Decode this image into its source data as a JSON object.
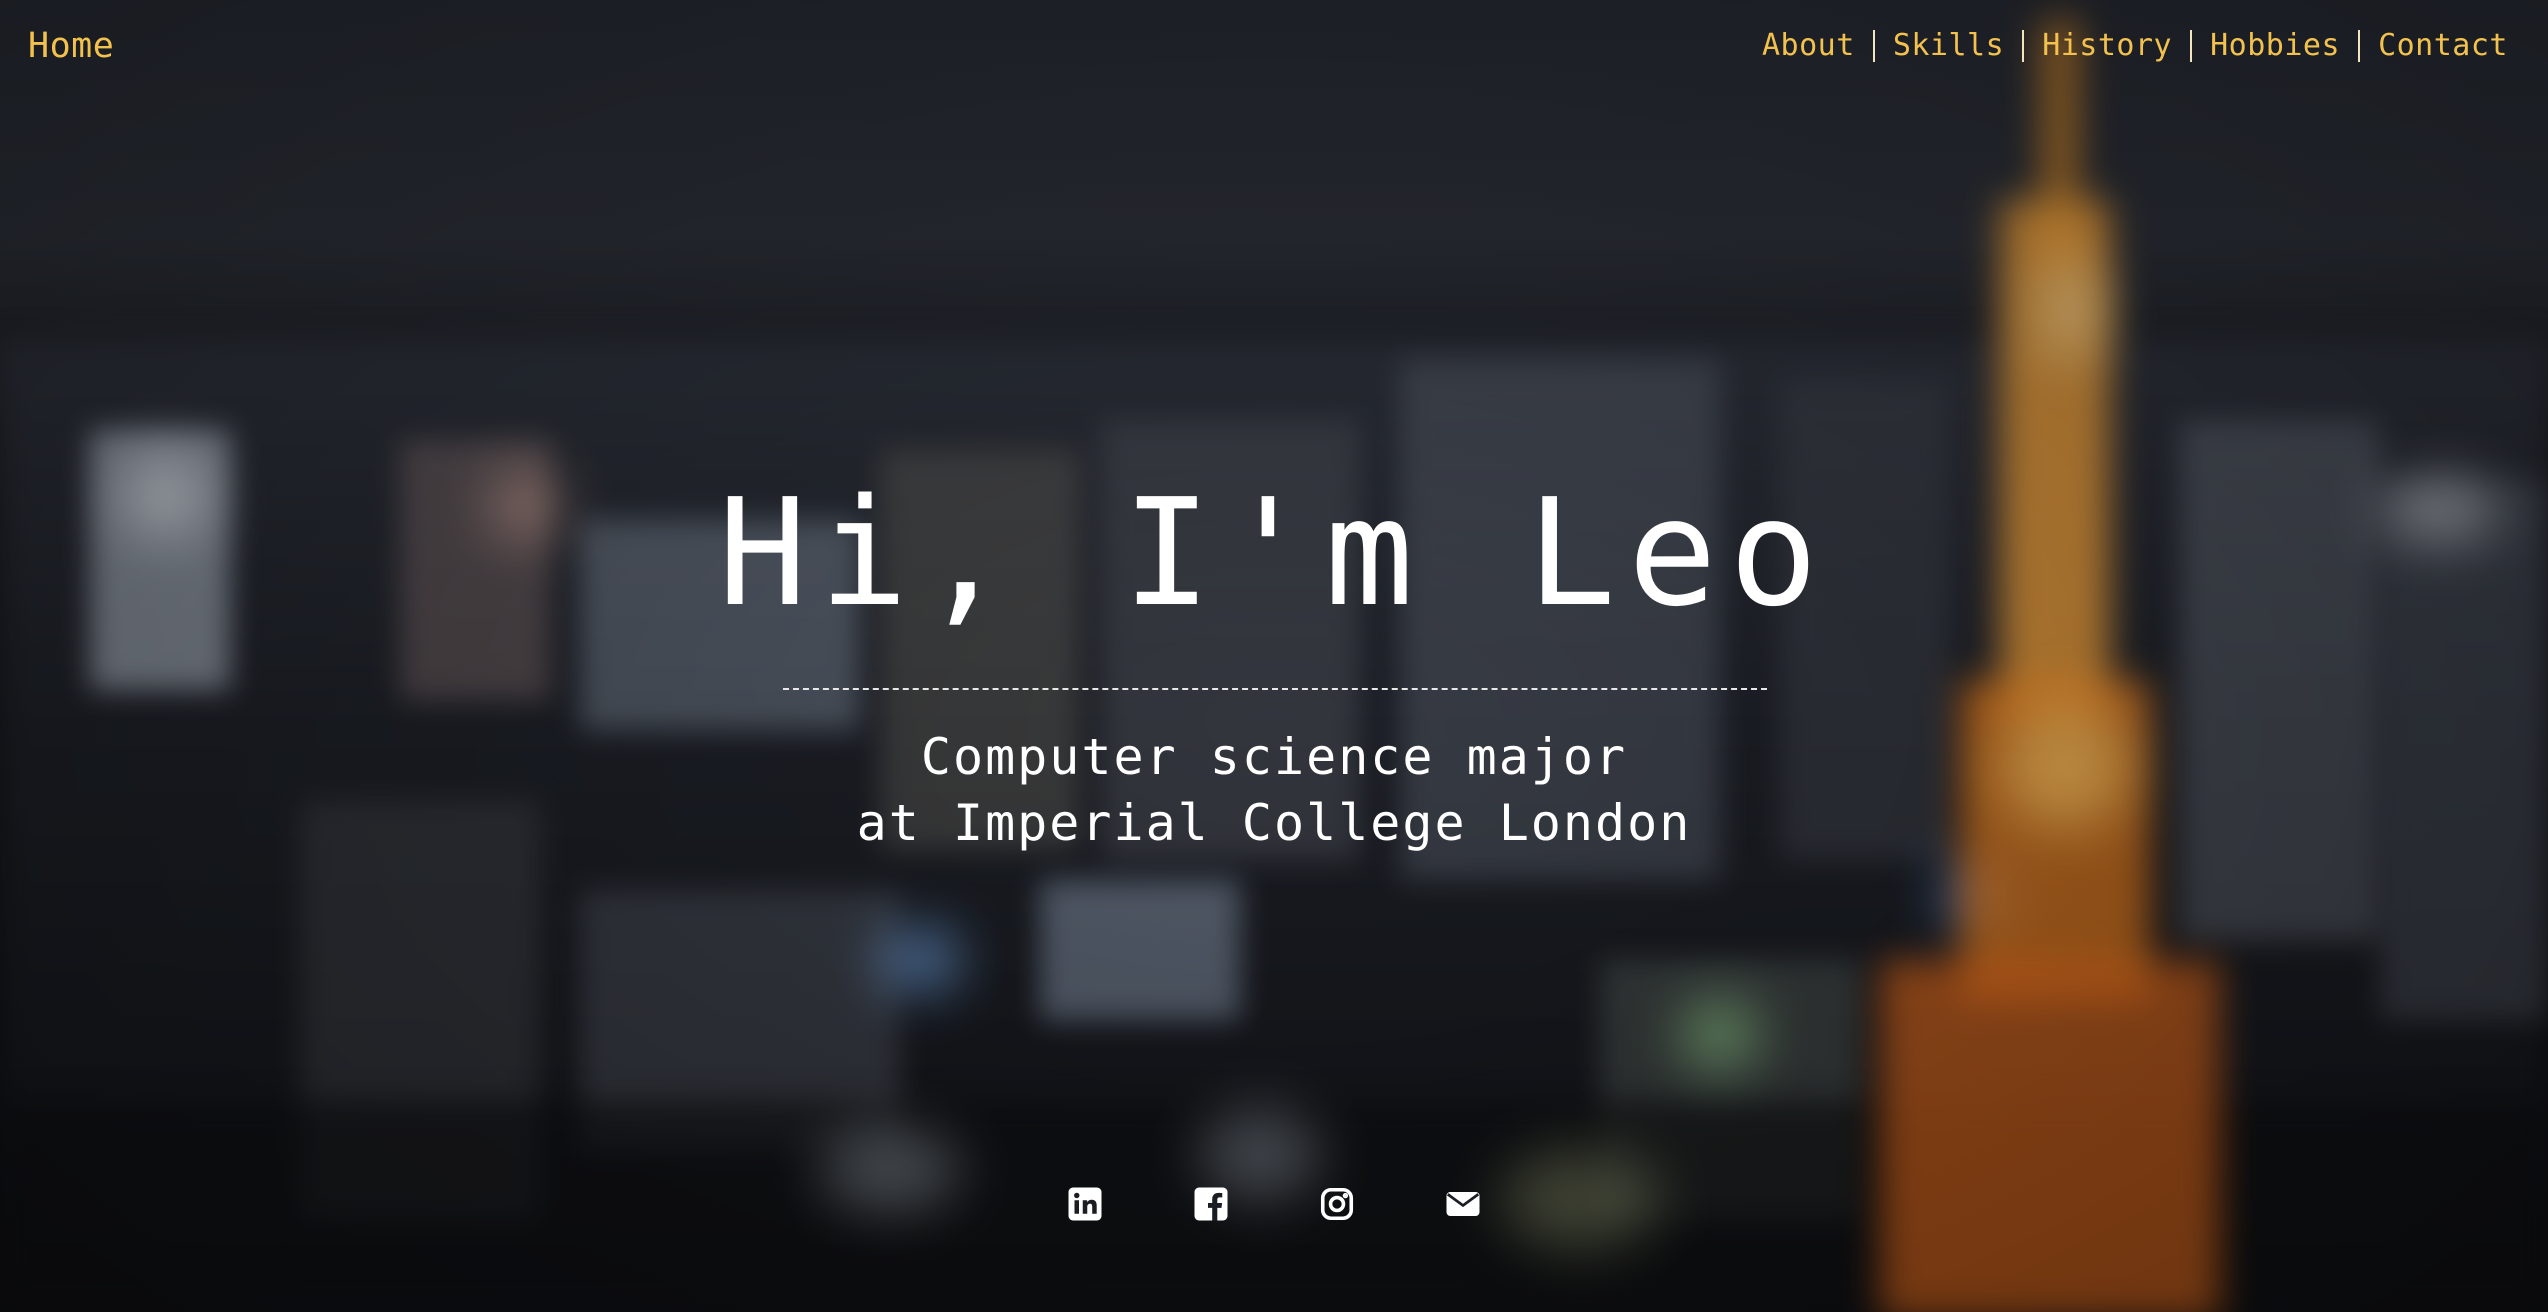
{
  "nav": {
    "home_label": "Home",
    "links": [
      {
        "label": "About"
      },
      {
        "label": "Skills"
      },
      {
        "label": "History"
      },
      {
        "label": "Hobbies"
      },
      {
        "label": "Contact"
      }
    ]
  },
  "hero": {
    "title": "Hi, I'm Leo",
    "subtitle_line1": "Computer science major",
    "subtitle_line2": "at Imperial College London"
  },
  "social": {
    "icons": [
      "linkedin-icon",
      "facebook-icon",
      "instagram-icon",
      "envelope-icon"
    ]
  },
  "colors": {
    "accent": "#f2c14e",
    "text": "#ffffff",
    "background": "#1a1d24"
  }
}
